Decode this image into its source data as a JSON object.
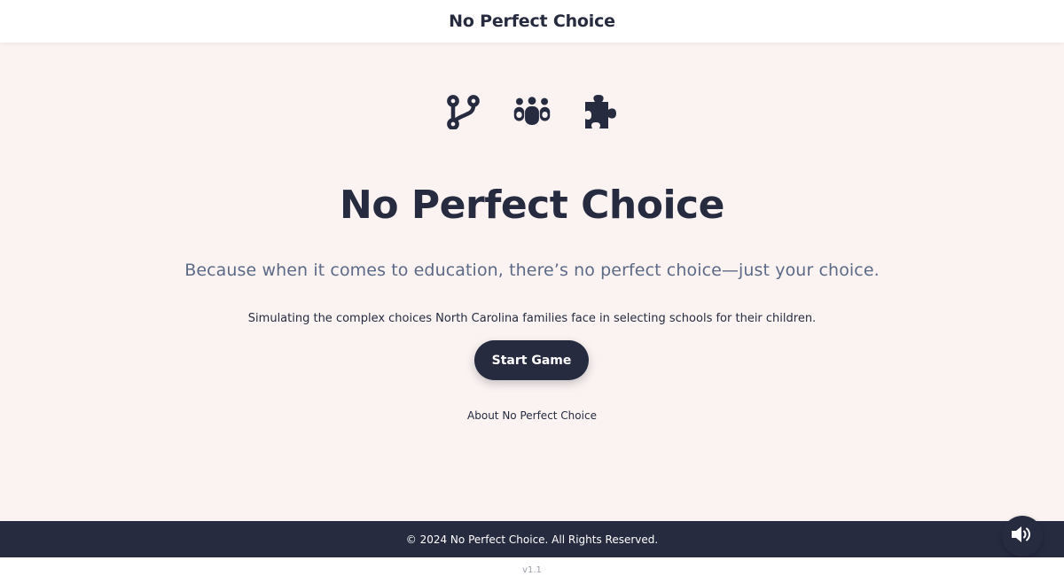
{
  "header": {
    "title": "No Perfect Choice"
  },
  "icons": [
    "branch-icon",
    "people-group-icon",
    "puzzle-piece-icon"
  ],
  "hero": {
    "title": "No Perfect Choice",
    "tagline": "Because when it comes to education, there’s no perfect choice—just your choice.",
    "subtitle": "Simulating the complex choices North Carolina families face in selecting schools for their children."
  },
  "actions": {
    "start_label": "Start Game",
    "about_label": "About No Perfect Choice"
  },
  "footer": {
    "copyright": "© 2024 No Perfect Choice. All Rights Reserved.",
    "version": "v1.1"
  },
  "colors": {
    "background": "#fbf3f1",
    "primary": "#262b40",
    "tagline": "#5c6a87"
  }
}
